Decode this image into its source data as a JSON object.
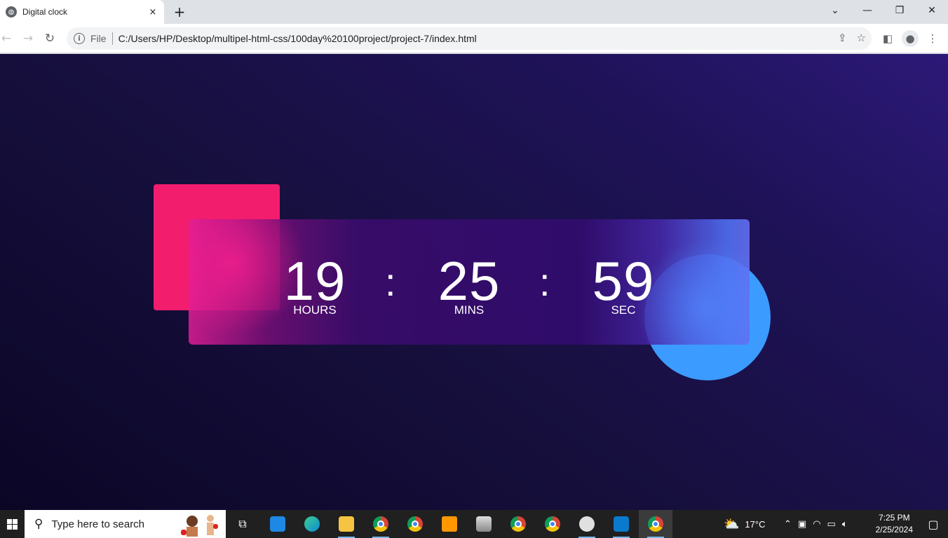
{
  "browser": {
    "tab_title": "Digital clock",
    "tab_close": "×",
    "new_tab": "+",
    "window_controls": {
      "dropdown": "⌄",
      "minimize": "—",
      "restore": "❐",
      "close": "✕"
    },
    "scheme_label": "File",
    "url": "C:/Users/HP/Desktop/multipel-html-css/100day%20100project/project-7/index.html"
  },
  "clock": {
    "hours": "19",
    "minutes": "25",
    "seconds": "59",
    "hours_label": "HOURS",
    "minutes_label": "MINS",
    "seconds_label": "SEC",
    "separator": ":"
  },
  "colors": {
    "square": "#f31d6e",
    "circle": "#3c9bff",
    "background_dark": "#0b0626",
    "background_light": "#2c1978"
  },
  "taskbar": {
    "search_placeholder": "Type here to search",
    "weather": "17°C",
    "time": "7:25 PM",
    "date": "2/25/2024",
    "icons": [
      "task-view-icon",
      "mail-icon",
      "edge-icon",
      "file-explorer-icon",
      "chrome-profile-icon",
      "chrome-icon",
      "sublime-text-icon",
      "app-icon",
      "chrome-icon",
      "chrome-icon",
      "paint-icon",
      "vscode-icon",
      "chrome-icon"
    ]
  }
}
